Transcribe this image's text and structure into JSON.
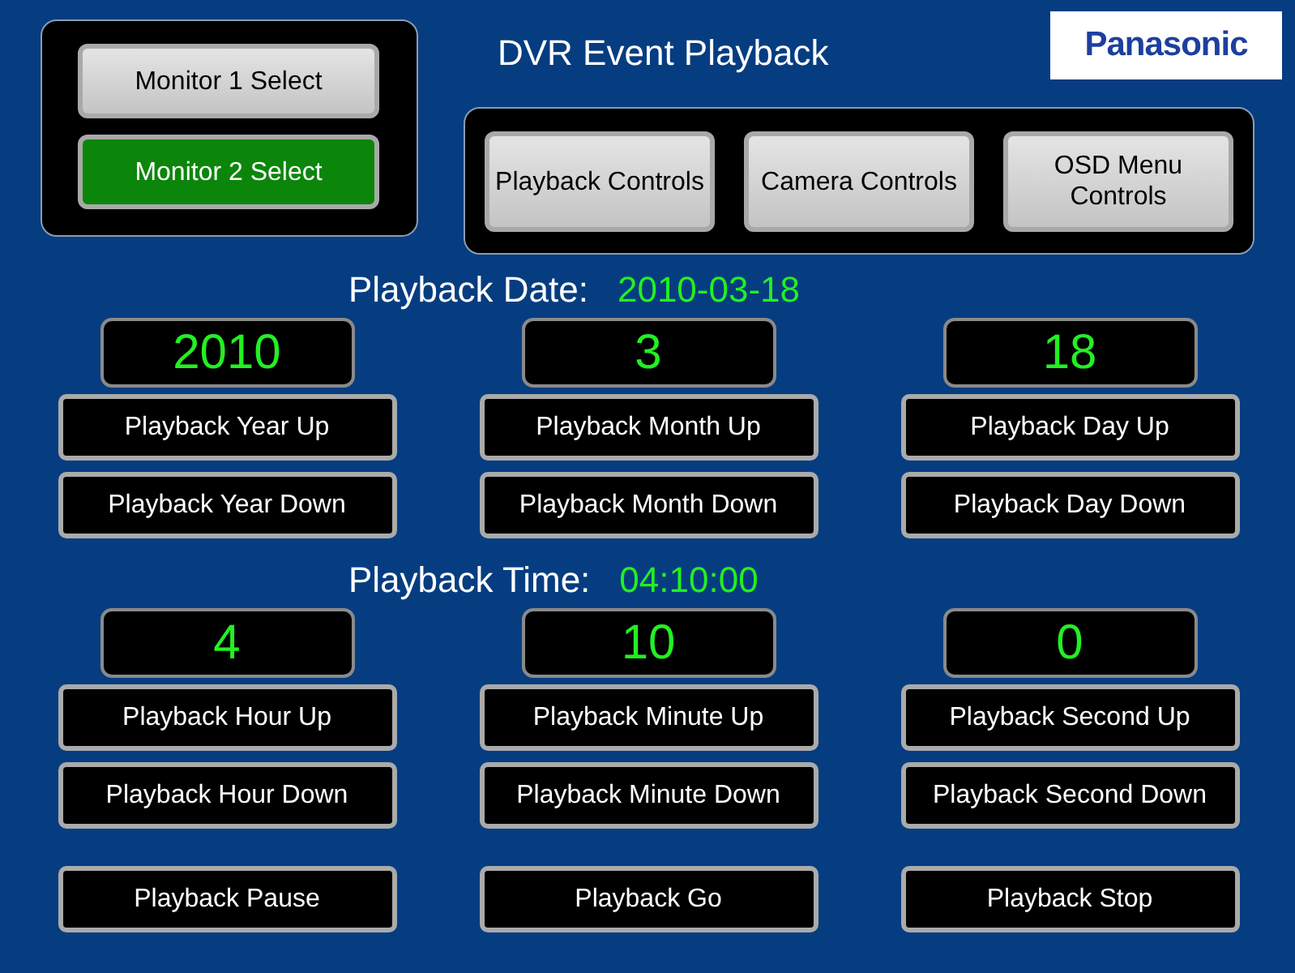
{
  "monitors": [
    {
      "label": "Monitor 1 Select",
      "selected": false
    },
    {
      "label": "Monitor 2 Select",
      "selected": true
    }
  ],
  "title": "DVR Event Playback",
  "logo": "Panasonic",
  "menu_buttons": [
    "Playback Controls",
    "Camera Controls",
    "OSD Menu Controls"
  ],
  "sections": [
    {
      "label": "Playback Date:",
      "value": "2010-03-18",
      "fields": [
        {
          "display": "2010",
          "up": "Playback Year Up",
          "down": "Playback Year Down"
        },
        {
          "display": "3",
          "up": "Playback Month Up",
          "down": "Playback Month Down"
        },
        {
          "display": "18",
          "up": "Playback Day Up",
          "down": "Playback Day Down"
        }
      ]
    },
    {
      "label": "Playback Time:",
      "value": "04:10:00",
      "fields": [
        {
          "display": "4",
          "up": "Playback Hour Up",
          "down": "Playback Hour Down"
        },
        {
          "display": "10",
          "up": "Playback Minute Up",
          "down": "Playback Minute Down"
        },
        {
          "display": "0",
          "up": "Playback Second Up",
          "down": "Playback Second Down"
        }
      ]
    }
  ],
  "transport": [
    "Playback Pause",
    "Playback Go",
    "Playback Stop"
  ]
}
